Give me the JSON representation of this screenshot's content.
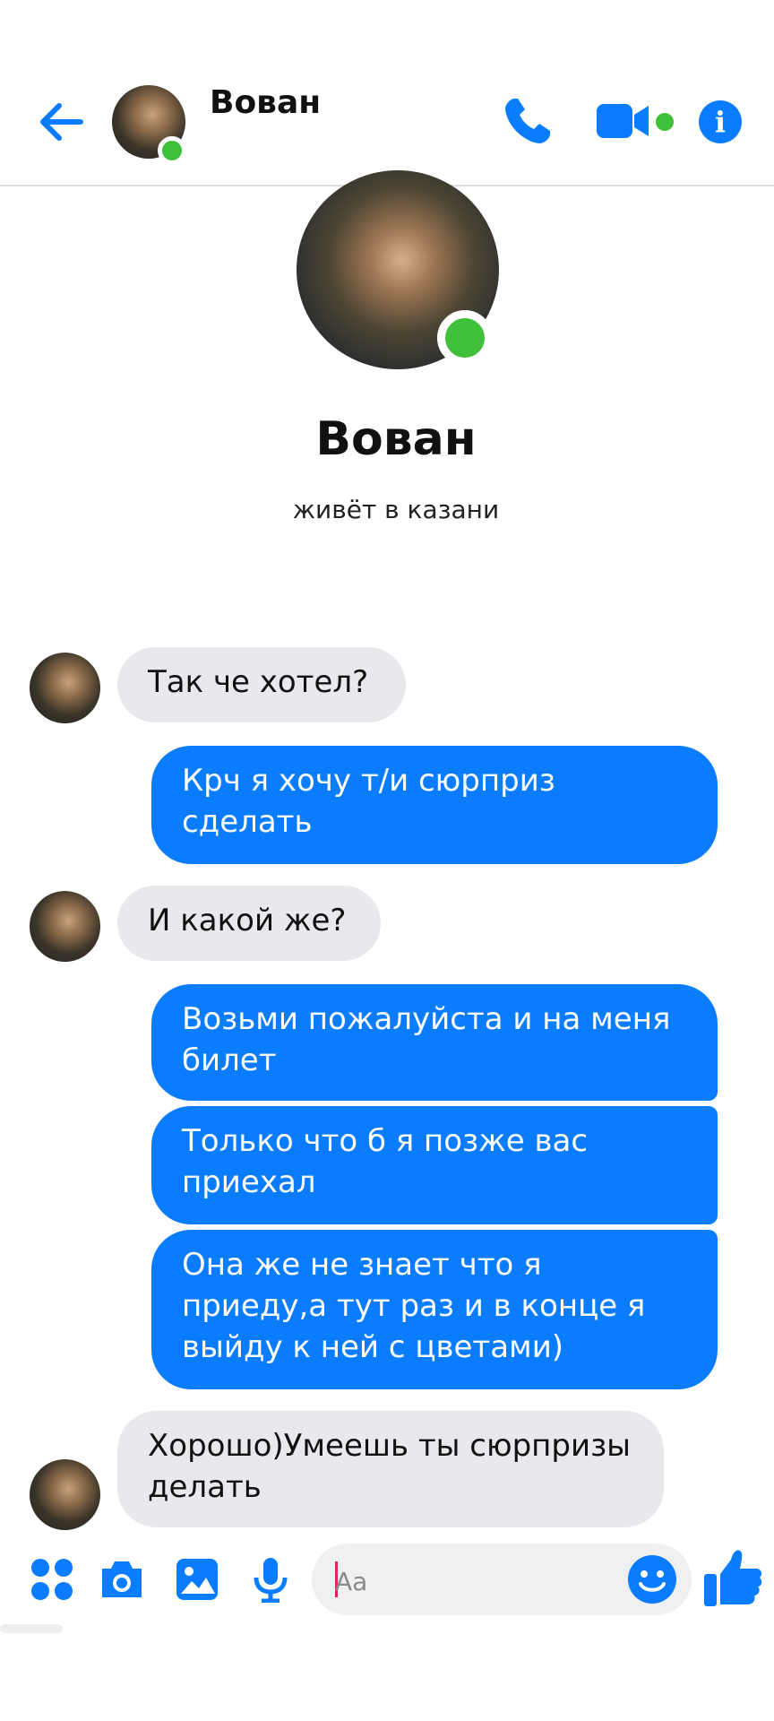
{
  "header": {
    "contact_name": "Вован",
    "back_icon": "arrow-left-icon",
    "call_icon": "phone-icon",
    "video_icon": "video-camera-icon",
    "info_icon": "info-icon",
    "info_glyph": "i",
    "accent_color": "#0a7cff",
    "online_color": "#3fbf3a"
  },
  "profile": {
    "name": "Вован",
    "status": "живёт в казани"
  },
  "messages": [
    {
      "from": "contact",
      "text": "Так че хотел?"
    },
    {
      "from": "me",
      "text": "Крч я хочу т/и сюрприз сделать"
    },
    {
      "from": "contact",
      "text": "И какой же?"
    },
    {
      "from": "me",
      "text": "Возьми пожалуйста и на меня билет"
    },
    {
      "from": "me",
      "text": "Только что б я позже вас приехал"
    },
    {
      "from": "me",
      "text": "Она же не знает что я приеду,а тут раз и в конце я выйду к ней с цветами)"
    },
    {
      "from": "contact",
      "text": "Хорошо)Умеешь ты сюрпризы делать"
    }
  ],
  "composer": {
    "placeholder": "Aa",
    "menu_icon": "four-dots-menu-icon",
    "camera_icon": "camera-icon",
    "gallery_icon": "image-gallery-icon",
    "mic_icon": "microphone-icon",
    "emoji_icon": "smiley-icon",
    "like_icon": "thumbs-up-icon"
  }
}
